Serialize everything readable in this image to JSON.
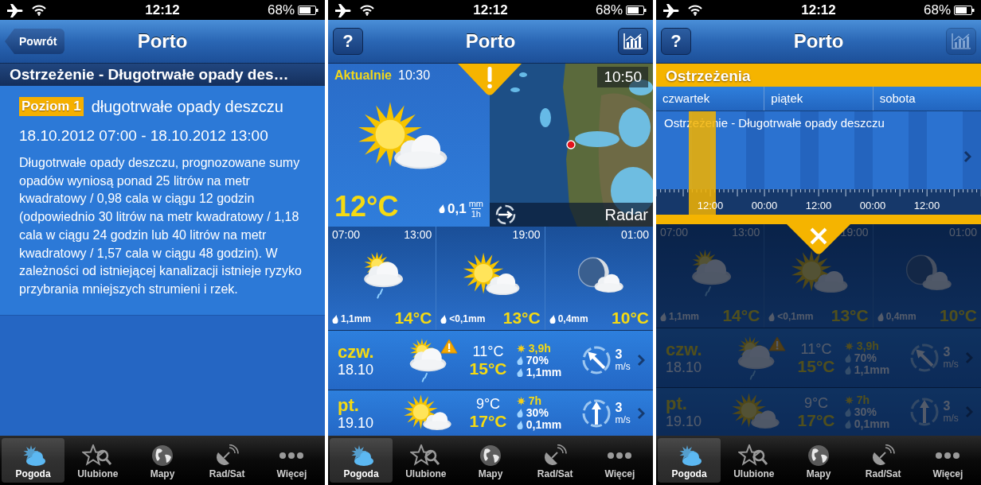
{
  "screens": [
    {
      "kind": "warning_detail",
      "status_bar": {
        "time": "12:12",
        "battery": "68%"
      },
      "nav": {
        "back_button": "Powrót",
        "title": "Porto"
      },
      "warning_title": "Ostrzeżenie - Długotrwałe opady des…",
      "level_badge": "Poziom 1",
      "headline": "długotrwałe opady deszczu",
      "period": "18.10.2012 07:00 - 18.10.2012 13:00",
      "description": "Długotrwałe opady deszczu, prognozowane sumy opadów wyniosą ponad 25 litrów na metr kwadratowy / 0,98 cala w ciągu 12 godzin (odpowiednio 30 litrów na metr kwadratowy / 1,18 cala w ciągu 24 godzin lub 40 litrów na metr kwadratowy / 1,57 cala w ciągu 48 godzin). W zależności od istniejącej kanalizacji istnieje ryzyko przybrania mniejszych strumieni i rzek.",
      "tabs": [
        {
          "kind": "weather",
          "label": "Pogoda",
          "selected": true
        },
        {
          "kind": "favorites",
          "label": "Ulubione",
          "selected": false
        },
        {
          "kind": "maps",
          "label": "Mapy",
          "selected": false
        },
        {
          "kind": "radar",
          "label": "Rad/Sat",
          "selected": false
        },
        {
          "kind": "more",
          "label": "Więcej",
          "selected": false
        }
      ]
    },
    {
      "kind": "forecast",
      "status_bar": {
        "time": "12:12",
        "battery": "68%"
      },
      "nav": {
        "help_button": "?",
        "title": "Porto",
        "chart_button_disabled": false
      },
      "current": {
        "label": "Aktualnie",
        "time": "10:30",
        "kind": "sun_cloud",
        "temperature": "12°C",
        "precipitation": "0,1",
        "unit_top": "mm",
        "unit_bottom": "1h"
      },
      "radar": {
        "time": "10:50",
        "label": "Radar"
      },
      "hourly_times": [
        "07:00",
        "13:00",
        "19:00",
        "01:00"
      ],
      "hourly": [
        {
          "kind": "sun_cloud_rain",
          "precipitation": "1,1mm",
          "temperature": "14°C"
        },
        {
          "kind": "sun_cloud",
          "precipitation": "<0,1mm",
          "temperature": "13°C"
        },
        {
          "kind": "moon_cloud",
          "precipitation": "0,4mm",
          "temperature": "10°C"
        }
      ],
      "days": [
        {
          "day": "czw.",
          "date": "18.10",
          "kind": "sun_cloud_rain",
          "warning": true,
          "temp_min": "11°C",
          "temp_max": "15°C",
          "sunshine": "3,9h",
          "precip_chance": "70%",
          "precipitation": "1,1mm",
          "wind": {
            "kind": "northwest",
            "speed": "3",
            "unit": "m/s"
          }
        },
        {
          "day": "pt.",
          "date": "19.10",
          "kind": "sun_cloud",
          "warning": false,
          "temp_min": "9°C",
          "temp_max": "17°C",
          "sunshine": "7h",
          "precip_chance": "30%",
          "precipitation": "0,1mm",
          "wind": {
            "kind": "north",
            "speed": "3",
            "unit": "m/s"
          }
        }
      ],
      "tabs": [
        {
          "kind": "weather",
          "label": "Pogoda",
          "selected": true
        },
        {
          "kind": "favorites",
          "label": "Ulubione",
          "selected": false
        },
        {
          "kind": "maps",
          "label": "Mapy",
          "selected": false
        },
        {
          "kind": "radar",
          "label": "Rad/Sat",
          "selected": false
        },
        {
          "kind": "more",
          "label": "Więcej",
          "selected": false
        }
      ]
    },
    {
      "kind": "forecast_warnings",
      "status_bar": {
        "time": "12:12",
        "battery": "68%"
      },
      "nav": {
        "help_button": "?",
        "title": "Porto",
        "chart_button_disabled": true
      },
      "warnings": {
        "title": "Ostrzeżenia",
        "days": [
          "czwartek",
          "piątek",
          "sobota"
        ],
        "warning": "Ostrzeżenie - Długotrwałe opady deszczu",
        "times": [
          "12:00",
          "00:00",
          "12:00",
          "00:00",
          "12:00"
        ]
      },
      "hourly_times": [
        "07:00",
        "13:00",
        "19:00",
        "01:00"
      ],
      "hourly": [
        {
          "kind": "sun_cloud_rain",
          "precipitation": "1,1mm",
          "temperature": "14°C"
        },
        {
          "kind": "sun_cloud",
          "precipitation": "<0,1mm",
          "temperature": "13°C"
        },
        {
          "kind": "moon_cloud",
          "precipitation": "0,4mm",
          "temperature": "10°C"
        }
      ],
      "days": [
        {
          "day": "czw.",
          "date": "18.10",
          "kind": "sun_cloud_rain",
          "warning": true,
          "temp_min": "11°C",
          "temp_max": "15°C",
          "sunshine": "3,9h",
          "precip_chance": "70%",
          "precipitation": "1,1mm",
          "wind": {
            "kind": "northwest",
            "speed": "3",
            "unit": "m/s"
          }
        },
        {
          "day": "pt.",
          "date": "19.10",
          "kind": "sun_cloud",
          "warning": false,
          "temp_min": "9°C",
          "temp_max": "17°C",
          "sunshine": "7h",
          "precip_chance": "30%",
          "precipitation": "0,1mm",
          "wind": {
            "kind": "north",
            "speed": "3",
            "unit": "m/s"
          }
        }
      ],
      "tabs": [
        {
          "kind": "weather",
          "label": "Pogoda",
          "selected": true
        },
        {
          "kind": "favorites",
          "label": "Ulubione",
          "selected": false
        },
        {
          "kind": "maps",
          "label": "Mapy",
          "selected": false
        },
        {
          "kind": "radar",
          "label": "Rad/Sat",
          "selected": false
        },
        {
          "kind": "more",
          "label": "Więcej",
          "selected": false
        }
      ]
    }
  ]
}
